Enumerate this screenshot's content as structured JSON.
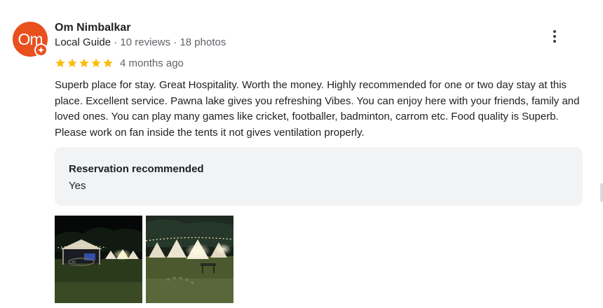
{
  "reviewer": {
    "avatar_text": "Om",
    "name": "Om Nimbalkar",
    "badge": "Local Guide",
    "reviews": "10 reviews",
    "photos": "18 photos",
    "separator": "·"
  },
  "review": {
    "rating": 5,
    "max_rating": 5,
    "time": "4 months ago",
    "text": "Superb place for stay. Great Hospitality. Worth the money. Highly recommended for one or two day stay at this place. Excellent service. Pawna lake gives you refreshing Vibes. You can enjoy here with your friends, family and loved ones. You can play many games like cricket, footballer, badminton, carrom etc. Food quality is Superb. Please work on fan inside the tents it not gives ventilation properly."
  },
  "attribute": {
    "title": "Reservation recommended",
    "value": "Yes"
  },
  "photos": [
    {
      "kind": "night-camp-gazebo"
    },
    {
      "kind": "night-camp-tents"
    }
  ],
  "icons": {
    "more": "more-vert-icon",
    "star": "star-icon",
    "badge": "local-guide-badge-icon"
  },
  "colors": {
    "avatar_bg": "#e8501e",
    "star": "#fbbc04",
    "muted_text": "#5f6368",
    "attr_bg": "#f1f3f4"
  }
}
